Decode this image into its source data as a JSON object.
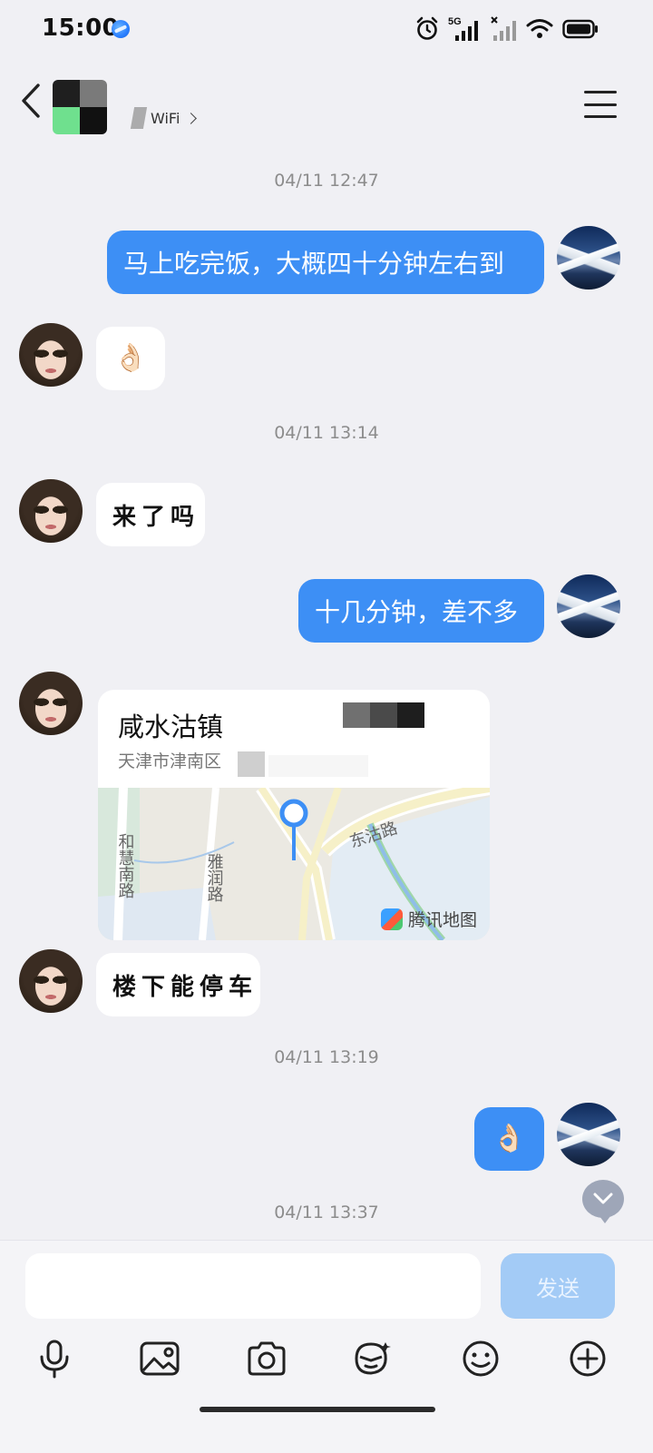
{
  "status_bar": {
    "time": "15:00",
    "network_label": "5G"
  },
  "header": {
    "subtitle": "WiFi"
  },
  "messages": {
    "ts1": "04/11 12:47",
    "m1": "马上吃完饭，大概四十分钟左右到",
    "m2_emoji": "👌🏻",
    "ts2": "04/11 13:14",
    "m3": "来了吗",
    "m4": "十几分钟，差不多",
    "location": {
      "title": "咸水沽镇",
      "address": "天津市津南区",
      "map_labels": {
        "road_1": "和慧南路",
        "road_2": "雅润路",
        "road_3": "东沽路"
      },
      "map_brand": "腾讯地图"
    },
    "m5": "楼下能停车",
    "ts3": "04/11 13:19",
    "m6_emoji": "👌🏻",
    "ts4": "04/11 13:37"
  },
  "composer": {
    "input_value": "",
    "send_label": "发送"
  },
  "colors": {
    "my_bubble": "#3d8ff5",
    "send_disabled": "#a3cbf6",
    "background": "#f0f0f4"
  }
}
